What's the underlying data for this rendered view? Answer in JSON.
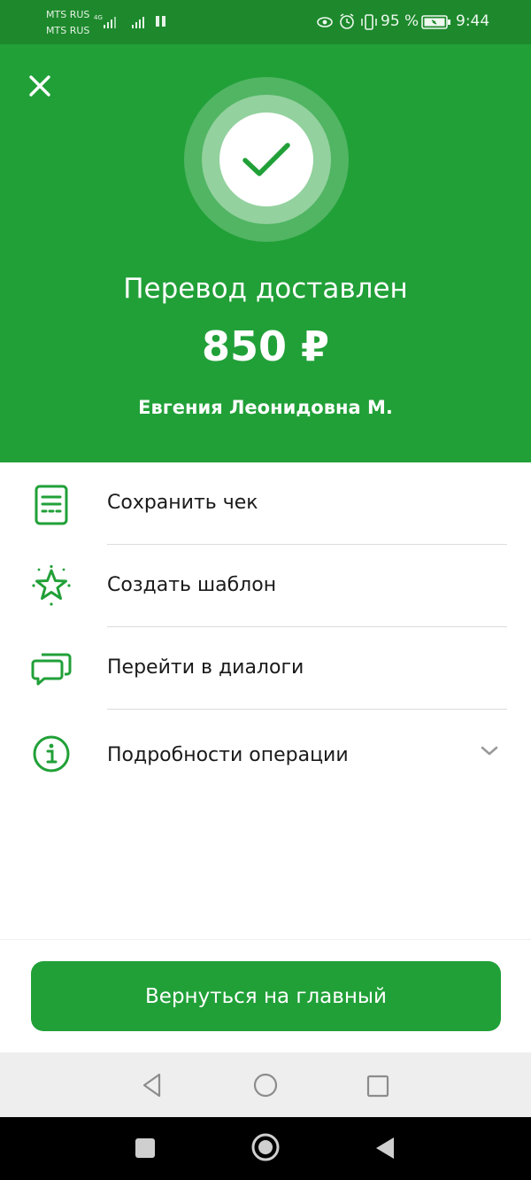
{
  "status_bar": {
    "carrier_1": "MTS RUS",
    "carrier_2": "MTS RUS",
    "network": "4G",
    "battery": "95 %",
    "time": "9:44"
  },
  "hero": {
    "close_icon": "close-icon",
    "status_icon": "check-icon",
    "title": "Перевод доставлен",
    "amount": "850 ₽",
    "recipient": "Евгения Леонидовна М."
  },
  "actions": [
    {
      "label": "Сохранить чек",
      "icon": "receipt-icon"
    },
    {
      "label": "Создать шаблон",
      "icon": "star-icon"
    },
    {
      "label": "Перейти в диалоги",
      "icon": "chat-icon"
    },
    {
      "label": "Подробности операции",
      "icon": "info-icon",
      "expand_icon": "chevron-down-icon"
    }
  ],
  "primary_button": {
    "label": "Вернуться на главный"
  },
  "colors": {
    "brand_green": "#21a038",
    "status_green": "#1d892c"
  }
}
